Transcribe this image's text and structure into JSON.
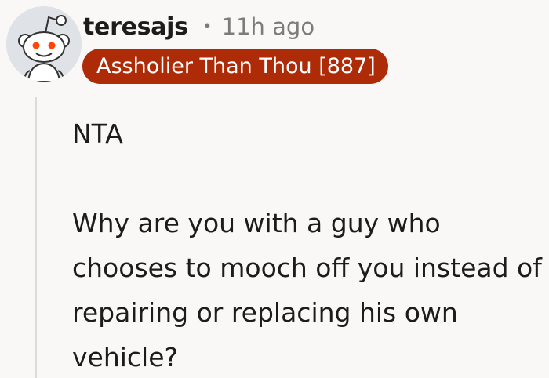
{
  "comment": {
    "author": "teresajs",
    "separator": "•",
    "time_ago": "11h ago",
    "flair": "Assholier Than Thou [887]",
    "body": [
      "NTA",
      "Why are you with a guy who chooses to mooch off you instead of repairing or replacing his own vehicle?"
    ]
  },
  "icons": {
    "avatar": "reddit-snoo-avatar-icon"
  },
  "colors": {
    "background": "#f9f8f6",
    "flair_bg": "#ad2b07",
    "flair_text": "#ffffff",
    "muted_text": "#7c7c7c",
    "thread_line": "#dcdbd8"
  }
}
